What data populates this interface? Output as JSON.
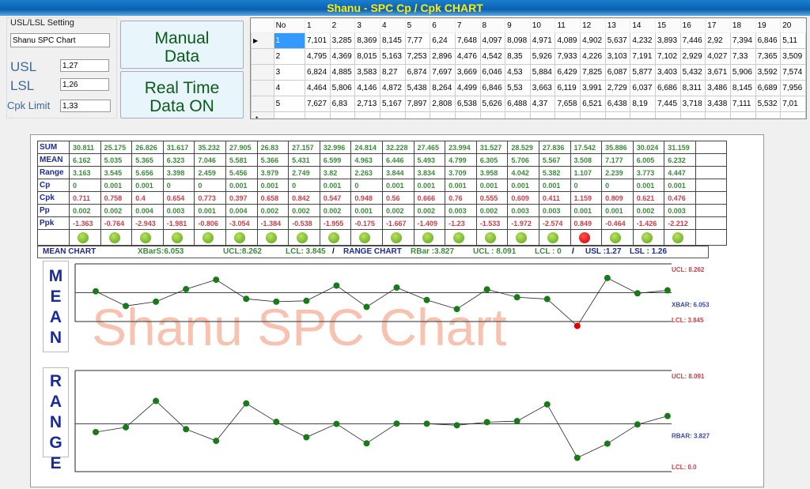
{
  "title": "Shanu - SPC Cp / Cpk CHART",
  "settings": {
    "group_title": "USL/LSL Setting",
    "chart_name": "Shanu SPC Chart",
    "usl_label": "USL",
    "usl": "1,27",
    "lsl_label": "LSL",
    "lsl": "1,26",
    "cpk_label": "Cpk Limit",
    "cpk": "1,33"
  },
  "buttons": {
    "manual": "Manual Data",
    "realtime": "Real Time Data ON"
  },
  "grid": {
    "no_header": "No",
    "columns": [
      "1",
      "2",
      "3",
      "4",
      "5",
      "6",
      "7",
      "8",
      "9",
      "10",
      "11",
      "12",
      "13",
      "14",
      "15",
      "16",
      "17",
      "18",
      "19",
      "20"
    ],
    "rows": [
      {
        "no": "1",
        "values": [
          "7,101",
          "3,285",
          "8,369",
          "8,145",
          "7,77",
          "6,24",
          "7,648",
          "4,097",
          "8,098",
          "4,971",
          "4,089",
          "4,902",
          "5,637",
          "4,232",
          "3,893",
          "7,446",
          "2,92",
          "7,394",
          "6,846",
          "5,11"
        ]
      },
      {
        "no": "2",
        "values": [
          "4,795",
          "4,369",
          "8,015",
          "5,163",
          "7,253",
          "2,896",
          "4,476",
          "4,542",
          "8,35",
          "5,926",
          "7,933",
          "4,226",
          "3,103",
          "7,191",
          "7,102",
          "2,929",
          "4,027",
          "7,33",
          "7,365",
          "3,509"
        ]
      },
      {
        "no": "3",
        "values": [
          "6,824",
          "4,885",
          "3,583",
          "8,27",
          "6,874",
          "7,697",
          "3,669",
          "6,046",
          "4,53",
          "5,884",
          "6,429",
          "7,825",
          "6,087",
          "5,877",
          "3,403",
          "5,432",
          "3,671",
          "5,906",
          "3,592",
          "7,574"
        ]
      },
      {
        "no": "4",
        "values": [
          "4,464",
          "5,806",
          "4,146",
          "4,872",
          "5,438",
          "8,264",
          "4,499",
          "6,846",
          "5,53",
          "3,663",
          "6,119",
          "3,991",
          "2,729",
          "6,037",
          "6,686",
          "8,311",
          "3,486",
          "8,145",
          "6,689",
          "7,956"
        ]
      },
      {
        "no": "5",
        "values": [
          "7,627",
          "6,83",
          "2,713",
          "5,167",
          "7,897",
          "2,808",
          "6,538",
          "5,626",
          "6,488",
          "4,37",
          "7,658",
          "6,521",
          "6,438",
          "8,19",
          "7,445",
          "3,718",
          "3,438",
          "7,111",
          "5,532",
          "7,01"
        ]
      }
    ]
  },
  "stats": {
    "rows": [
      {
        "label": "SUM",
        "color": "green",
        "values": [
          "30.811",
          "25.175",
          "26.826",
          "31.617",
          "35.232",
          "27.905",
          "26.83",
          "27.157",
          "32.996",
          "24.814",
          "32.228",
          "27.465",
          "23.994",
          "31.527",
          "28.529",
          "27.836",
          "17.542",
          "35.886",
          "30.024",
          "31.159"
        ]
      },
      {
        "label": "MEAN",
        "color": "green",
        "values": [
          "6.162",
          "5.035",
          "5.365",
          "6.323",
          "7.046",
          "5.581",
          "5.366",
          "5.431",
          "6.599",
          "4.963",
          "6.446",
          "5.493",
          "4.799",
          "6.305",
          "5.706",
          "5.567",
          "3.508",
          "7.177",
          "6.005",
          "6.232"
        ]
      },
      {
        "label": "Range",
        "color": "green",
        "values": [
          "3.163",
          "3.545",
          "5.656",
          "3.398",
          "2.459",
          "5.456",
          "3.979",
          "2.749",
          "3.82",
          "2.263",
          "3.844",
          "3.834",
          "3.709",
          "3.958",
          "4.042",
          "5.382",
          "1.107",
          "2.239",
          "3.773",
          "4.447"
        ]
      },
      {
        "label": "Cp",
        "color": "green",
        "values": [
          "0",
          "0.001",
          "0.001",
          "0",
          "0",
          "0.001",
          "0.001",
          "0",
          "0.001",
          "0",
          "0.001",
          "0.001",
          "0.001",
          "0.001",
          "0.001",
          "0.001",
          "0",
          "0",
          "0.001",
          "0.001"
        ]
      },
      {
        "label": "Cpk",
        "color": "red",
        "values": [
          "0.711",
          "0.758",
          "0.4",
          "0.654",
          "0.773",
          "0.397",
          "0.658",
          "0.842",
          "0.547",
          "0.948",
          "0.56",
          "0.666",
          "0.76",
          "0.555",
          "0.609",
          "0.411",
          "1.159",
          "0.809",
          "0.621",
          "0.476"
        ]
      },
      {
        "label": "Pp",
        "color": "green",
        "values": [
          "0.002",
          "0.002",
          "0.004",
          "0.003",
          "0.001",
          "0.004",
          "0.002",
          "0.002",
          "0.002",
          "0.001",
          "0.002",
          "0.002",
          "0.003",
          "0.002",
          "0.003",
          "0.003",
          "0.001",
          "0.001",
          "0.002",
          "0.003"
        ]
      },
      {
        "label": "Ppk",
        "color": "red",
        "values": [
          "-1.363",
          "-0.764",
          "-2.943",
          "-1.981",
          "-0.806",
          "-3.054",
          "-1.384",
          "-0.538",
          "-1.955",
          "-0.175",
          "-1.667",
          "-1.409",
          "-1.23",
          "-1.533",
          "-1.972",
          "-2.574",
          "0.849",
          "-0.464",
          "-1.426",
          "-2.212"
        ]
      }
    ],
    "status": [
      "ok",
      "ok",
      "ok",
      "ok",
      "ok",
      "ok",
      "ok",
      "ok",
      "ok",
      "ok",
      "ok",
      "ok",
      "ok",
      "ok",
      "ok",
      "ok",
      "bad",
      "ok",
      "ok",
      "ok"
    ]
  },
  "summary": {
    "mean_chart": "MEAN CHART",
    "xbar": "XBarS:6.053",
    "mean_ucl": "UCL:8.262",
    "mean_lcl": "LCL: 3.845",
    "range_chart": "RANGE CHART",
    "rbar": "RBar :3.827",
    "range_ucl": "UCL : 8.091",
    "range_lcl": "LCL : 0",
    "usl": "USL :1.27",
    "lsl": "LSL : 1.26",
    "sep": "/"
  },
  "watermark": "Shanu SPC Chart",
  "chart_data": [
    {
      "type": "line",
      "title": "MEAN",
      "ucl": 8.262,
      "cl": 6.053,
      "lcl": 3.845,
      "ucl_label": "UCL: 8.262",
      "cl_label": "XBAR: 6.053",
      "lcl_label": "LCL: 3.845",
      "values": [
        6.162,
        5.035,
        5.365,
        6.323,
        7.046,
        5.581,
        5.366,
        5.431,
        6.599,
        4.963,
        6.446,
        5.493,
        4.799,
        6.305,
        5.706,
        5.567,
        3.508,
        7.177,
        6.005,
        6.232
      ]
    },
    {
      "type": "line",
      "title": "RANGE",
      "ucl": 8.091,
      "cl": 3.827,
      "lcl": 0,
      "ucl_label": "UCL: 8.091",
      "cl_label": "RBAR: 3.827",
      "lcl_label": "LCL: 0.0",
      "values": [
        3.163,
        3.545,
        5.656,
        3.398,
        2.459,
        5.456,
        3.979,
        2.749,
        3.82,
        2.263,
        3.844,
        3.834,
        3.709,
        3.958,
        4.042,
        5.382,
        1.107,
        2.239,
        3.773,
        4.447
      ]
    }
  ],
  "colors": {
    "ok": "#1a7a1a",
    "bad": "#e00000",
    "ucl": "#c8404a",
    "cl": "#3a4a9a"
  }
}
